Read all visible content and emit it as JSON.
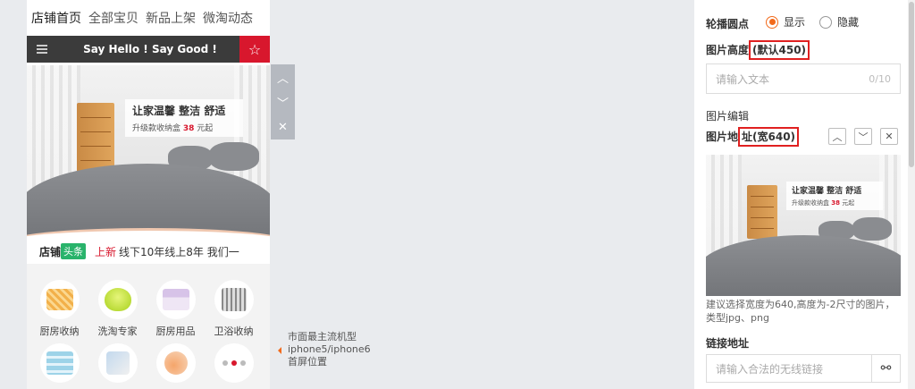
{
  "phone": {
    "tabs": [
      "店铺首页",
      "全部宝贝",
      "新品上架",
      "微淘动态"
    ],
    "banner_title": "Say Hello ! Say Good !",
    "menu_icon": "menu-icon",
    "star_icon": "star-icon",
    "star_glyph": "☆",
    "ad": {
      "title": "让家温馨  整洁  舒适",
      "sub_prefix": "升级款收纳盒",
      "price": "38",
      "sub_suffix": "元起"
    },
    "headline": {
      "shop": "店铺",
      "tag": "头条",
      "new_label": "上新",
      "text": "线下10年线上8年 我们一"
    },
    "categories": [
      {
        "label": "厨房收纳",
        "icon": "basket-icon"
      },
      {
        "label": "洗淘专家",
        "icon": "bowl-icon"
      },
      {
        "label": "厨房用品",
        "icon": "storage-box-icon"
      },
      {
        "label": "卫浴收纳",
        "icon": "bath-cart-icon"
      },
      {
        "label": "",
        "icon": "towel-icon"
      },
      {
        "label": "",
        "icon": "clip-icon"
      },
      {
        "label": "",
        "icon": "finger-icon"
      },
      {
        "label": "",
        "icon": "more-dots-icon"
      }
    ]
  },
  "controls": {
    "up_glyph": "︿",
    "down_glyph": "﹀",
    "close_glyph": "✕"
  },
  "screen_note": {
    "line1": "市面最主流机型",
    "line2": "iphone5/iphone6",
    "line3": "首屏位置"
  },
  "panel": {
    "carousel_dots_label": "轮播圆点",
    "radio_show": "显示",
    "radio_hide": "隐藏",
    "radio_selected": "显示",
    "height_label_prefix": "图片高度",
    "height_label_highlight": "(默认450)",
    "height_placeholder": "请输入文本",
    "height_counter": "0/10",
    "image_edit_label": "图片编辑",
    "image_url_prefix": "图片地",
    "image_url_highlight": "址(宽640)",
    "up_btn": "︿",
    "down_btn": "﹀",
    "close_btn": "✕",
    "preview_ad": {
      "title": "让家温馨  整洁  舒适",
      "sub_prefix": "升级款收纳盒",
      "price": "38",
      "sub_suffix": "元起"
    },
    "hint": "建议选择宽度为640,高度为-2尺寸的图片，类型jpg、png",
    "link_label": "链接地址",
    "link_placeholder": "请输入合法的无线链接",
    "link_icon": "link-icon",
    "link_glyph": "⚯"
  },
  "colors": {
    "accent_red": "#d8172d",
    "radio_orange": "#f26a1b",
    "headline_green": "#29b36b",
    "highlight_border": "#e02020"
  }
}
